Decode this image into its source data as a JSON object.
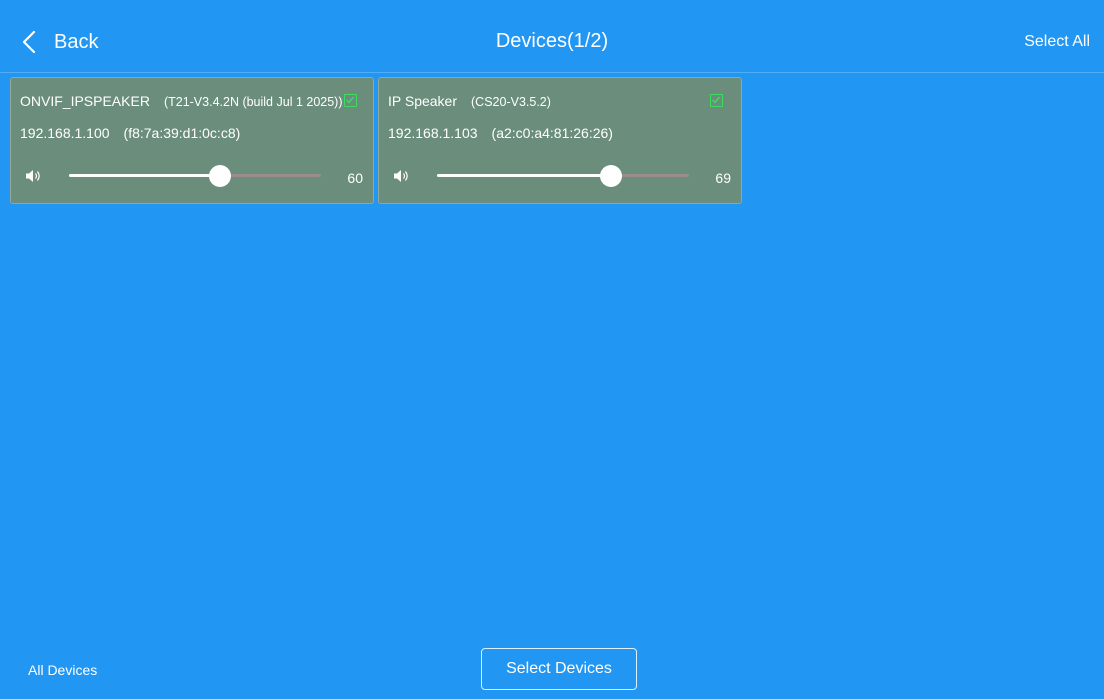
{
  "header": {
    "back_label": "Back",
    "title": "Devices(1/2)",
    "select_all_label": "Select All"
  },
  "devices": [
    {
      "name": "ONVIF_IPSPEAKER",
      "firmware": "(T21-V3.4.2N (build Jul  1 2025))",
      "ip": "192.168.1.100",
      "mac": "(f8:7a:39:d1:0c:c8)",
      "volume": "60",
      "volume_level": 60,
      "selected": true
    },
    {
      "name": "IP Speaker",
      "firmware": "(CS20-V3.5.2)",
      "ip": "192.168.1.103",
      "mac": "(a2:c0:a4:81:26:26)",
      "volume": "69",
      "volume_level": 69,
      "selected": true
    }
  ],
  "footer": {
    "all_devices_label": "All Devices",
    "select_devices_label": "Select Devices"
  },
  "colors": {
    "background": "#2196f3",
    "card": "#6b8d7c",
    "checkbox": "#3ddc5f",
    "slider_track": "#9b8c90"
  },
  "icons": {
    "back": "chevron-left-icon",
    "volume": "speaker-icon",
    "checkbox": "checkbox-checked-icon"
  }
}
